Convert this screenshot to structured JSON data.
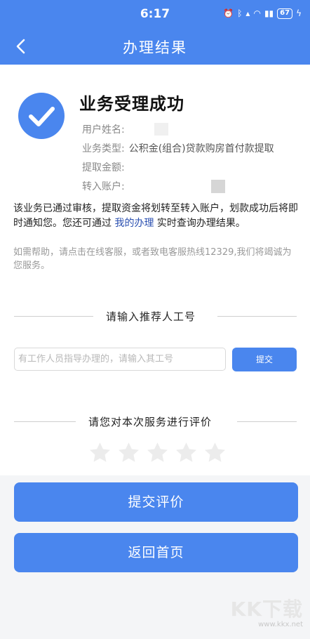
{
  "status_bar": {
    "time": "6:17",
    "battery": "67",
    "icons": [
      "alarm-icon",
      "bluetooth-icon",
      "signal-icon",
      "wifi-icon",
      "cellular-icon",
      "charging-icon"
    ]
  },
  "nav": {
    "title": "办理结果"
  },
  "result": {
    "title": "业务受理成功",
    "fields": [
      {
        "label": "用户姓名:",
        "value": ""
      },
      {
        "label": "业务类型:",
        "value": "公积金(组合)贷款购房首付款提取"
      },
      {
        "label": "提取金额:",
        "value": ""
      },
      {
        "label": "转入账户:",
        "value": ""
      }
    ],
    "notice_before": "该业务已通过审核，提取资金将划转至转入账户，划款成功后将即时通知您。您还可通过 ",
    "notice_link": "我的办理",
    "notice_after": " 实时查询办理结果。",
    "help": "如需帮助，请点击在线客服，或者致电客服热线12329,我们将竭诚为您服务。"
  },
  "referrer": {
    "section_title": "请输入推荐人工号",
    "placeholder": "有工作人员指导办理的，请输入其工号",
    "value": "",
    "submit_label": "提交"
  },
  "rating": {
    "section_title": "请您对本次服务进行评价",
    "max": 5,
    "value": 0
  },
  "actions": {
    "submit_rating_label": "提交评价",
    "home_label": "返回首页"
  },
  "watermark": {
    "logo": "KK下载",
    "url": "www.kkx.net"
  },
  "colors": {
    "primary": "#4a86ee",
    "star_inactive": "#ececec",
    "link": "#2a4fb0"
  }
}
